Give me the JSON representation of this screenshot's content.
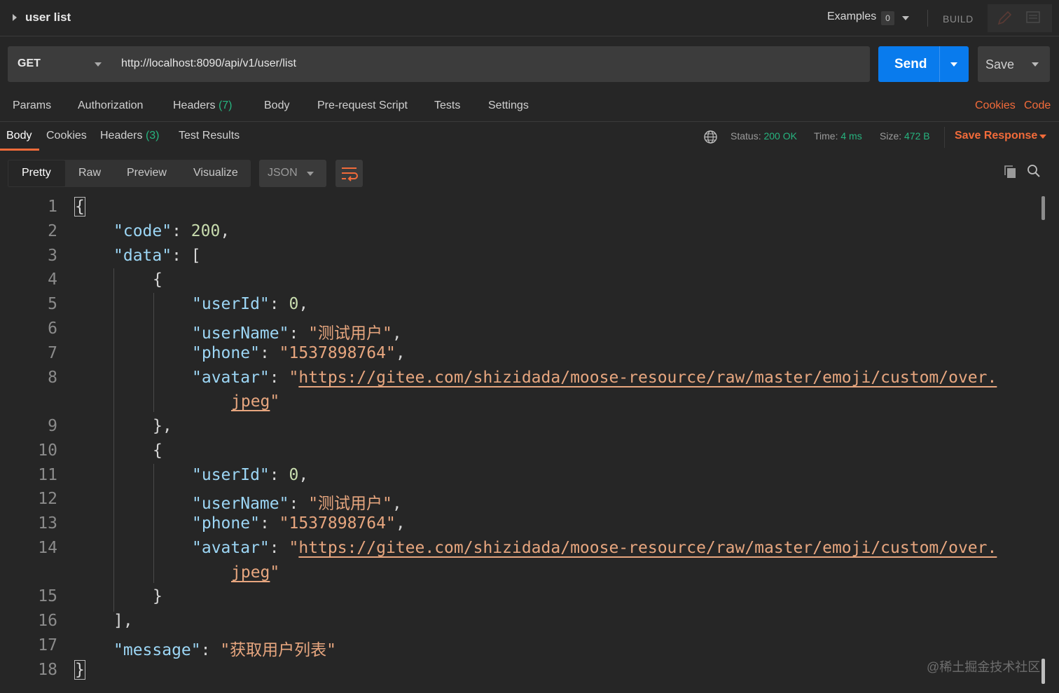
{
  "header": {
    "title": "user list",
    "examples_label": "Examples",
    "examples_count": "0",
    "build_label": "BUILD"
  },
  "request": {
    "method": "GET",
    "url": "http://localhost:8090/api/v1/user/list",
    "send_label": "Send",
    "save_label": "Save"
  },
  "request_tabs": {
    "params": "Params",
    "authorization": "Authorization",
    "headers": "Headers",
    "headers_count": "(7)",
    "body": "Body",
    "prerequest": "Pre-request Script",
    "tests": "Tests",
    "settings": "Settings",
    "cookies_link": "Cookies",
    "code_link": "Code"
  },
  "response_tabs": {
    "body": "Body",
    "cookies": "Cookies",
    "headers": "Headers",
    "headers_count": "(3)",
    "test_results": "Test Results"
  },
  "response_meta": {
    "status_label": "Status:",
    "status_value": "200 OK",
    "time_label": "Time:",
    "time_value": "4 ms",
    "size_label": "Size:",
    "size_value": "472 B",
    "save_response": "Save Response"
  },
  "view_modes": {
    "pretty": "Pretty",
    "raw": "Raw",
    "preview": "Preview",
    "visualize": "Visualize",
    "format": "JSON"
  },
  "code": {
    "line_numbers": [
      "1",
      "2",
      "3",
      "4",
      "5",
      "6",
      "7",
      "8",
      "9",
      "10",
      "11",
      "12",
      "13",
      "14",
      "15",
      "16",
      "17",
      "18"
    ],
    "open_brace": "{",
    "close_brace": "}",
    "code_key": "\"code\"",
    "code_value": "200",
    "data_key": "\"data\"",
    "open_bracket": "[",
    "close_bracket": "],",
    "item_open": "{",
    "item1_close": "},",
    "item2_close": "}",
    "userId_key": "\"userId\"",
    "userId_value": "0",
    "userName_key": "\"userName\"",
    "userName_value": "\"测试用户\"",
    "phone_key": "\"phone\"",
    "phone_value": "\"1537898764\"",
    "avatar_key": "\"avatar\"",
    "avatar_url_part1": "https://gitee.com/shizidada/moose-resource/raw/master/emoji/custom/over.",
    "avatar_url_part2": "jpeg",
    "message_key": "\"message\"",
    "message_value": "\"获取用户列表\""
  },
  "watermark": "@稀土掘金技术社区",
  "colors": {
    "accent_orange": "#f26b3a",
    "send_blue": "#097bed",
    "status_green": "#26b47f",
    "json_key": "#9cd6f5",
    "json_string": "#e7a67f",
    "json_number": "#c8dcae"
  }
}
